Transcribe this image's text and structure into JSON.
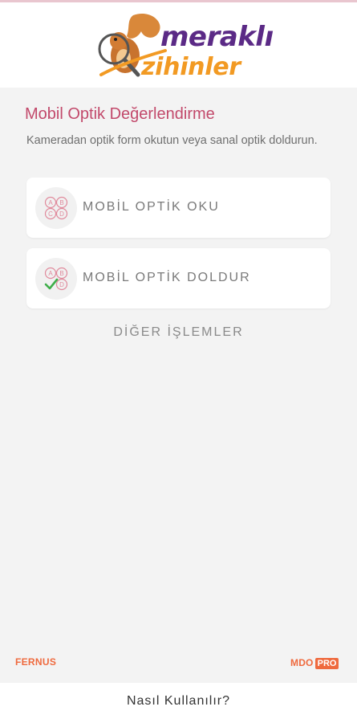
{
  "header": {
    "logo_line1": "meraklı",
    "logo_line2": "zihinler"
  },
  "main": {
    "title": "Mobil Optik Değerlendirme",
    "subtitle": "Kameradan optik form okutun veya sanal optik doldurun.",
    "cards": [
      {
        "label": "MOBİL OPTİK OKU",
        "icon": "bubble-sheet-icon"
      },
      {
        "label": "MOBİL OPTİK DOLDUR",
        "icon": "bubble-sheet-check-icon"
      }
    ],
    "more_label": "DİĞER İŞLEMLER",
    "bubble_letters": [
      "A",
      "B",
      "C",
      "D"
    ]
  },
  "brands": {
    "left": "FERNUS",
    "right_mdo": "MDO",
    "right_pro": "PRO"
  },
  "footer": {
    "help_label": "Nasıl Kullanılır?"
  },
  "colors": {
    "title": "#c2496b",
    "accent_orange": "#ef6a3e",
    "logo_purple": "#5b2a86",
    "logo_orange": "#f29a23",
    "check_green": "#3fae4a"
  }
}
